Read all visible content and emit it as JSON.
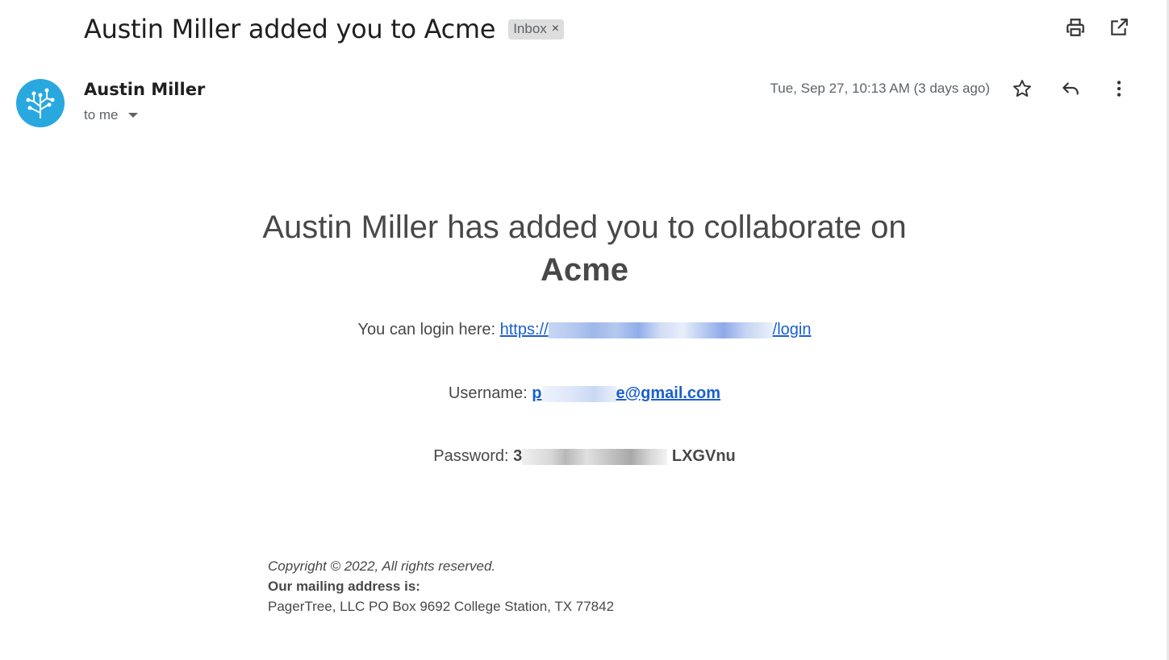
{
  "email": {
    "subject": "Austin Miller added you to Acme",
    "label": "Inbox",
    "label_remove": "×",
    "sender": "Austin Miller",
    "recipient": "to me",
    "date": "Tue, Sep 27, 10:13 AM (3 days ago)"
  },
  "body": {
    "headline_prefix": "Austin Miller has added you to collaborate on",
    "headline_org": "Acme",
    "login_prefix": "You can login here:",
    "login_url_start": "https://",
    "login_url_end": "/login",
    "username_label": "Username:",
    "username_start": "p",
    "username_end": "e@gmail.com",
    "password_label": "Password:",
    "password_start": "3",
    "password_end": "LXGVnu"
  },
  "footer": {
    "copyright": "Copyright © 2022, All rights reserved.",
    "mailing_label": "Our mailing address is:",
    "address": "PagerTree, LLC PO Box 9692 College Station, TX 77842"
  },
  "colors": {
    "avatar_bg": "#29a8df",
    "link": "#1a5fd1",
    "label_chip_bg": "#dddddd"
  },
  "icons": [
    "print-icon",
    "open-in-new-window-icon",
    "star-icon",
    "reply-icon",
    "more-vert-icon",
    "caret-down-icon",
    "tree-logo-icon"
  ]
}
